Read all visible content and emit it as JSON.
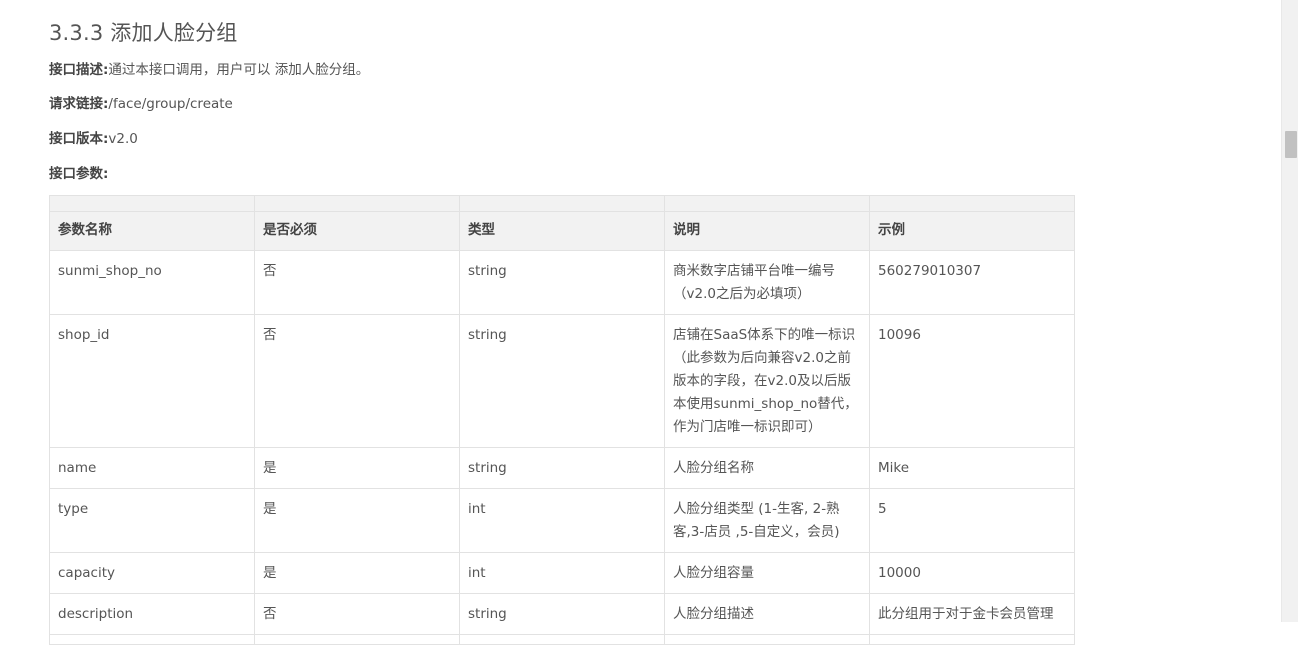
{
  "section": {
    "title": "3.3.3 添加人脸分组"
  },
  "meta": {
    "desc_key": "接口描述:",
    "desc_val": "通过本接口调用，用户可以 添加人脸分组。",
    "url_key": "请求链接:",
    "url_val": "/face/group/create",
    "version_key": "接口版本:",
    "version_val": "v2.0",
    "params_key": "接口参数:"
  },
  "table": {
    "headers": [
      "参数名称",
      "是否必须",
      "类型",
      "说明",
      "示例"
    ],
    "rows": [
      [
        "sunmi_shop_no",
        "否",
        "string",
        "商米数字店铺平台唯一编号（v2.0之后为必填项）",
        "560279010307"
      ],
      [
        "shop_id",
        "否",
        "string",
        "店铺在SaaS体系下的唯一标识（此参数为后向兼容v2.0之前版本的字段，在v2.0及以后版本使用sunmi_shop_no替代，作为门店唯一标识即可）",
        "10096"
      ],
      [
        "name",
        "是",
        "string",
        "人脸分组名称",
        "Mike"
      ],
      [
        "type",
        "是",
        "int",
        "人脸分组类型 (1-生客, 2-熟客,3-店员 ,5-自定义，会员)",
        "5"
      ],
      [
        "capacity",
        "是",
        "int",
        "人脸分组容量",
        "10000"
      ],
      [
        "description",
        "否",
        "string",
        "人脸分组描述",
        "此分组用于对于金卡会员管理"
      ]
    ]
  }
}
